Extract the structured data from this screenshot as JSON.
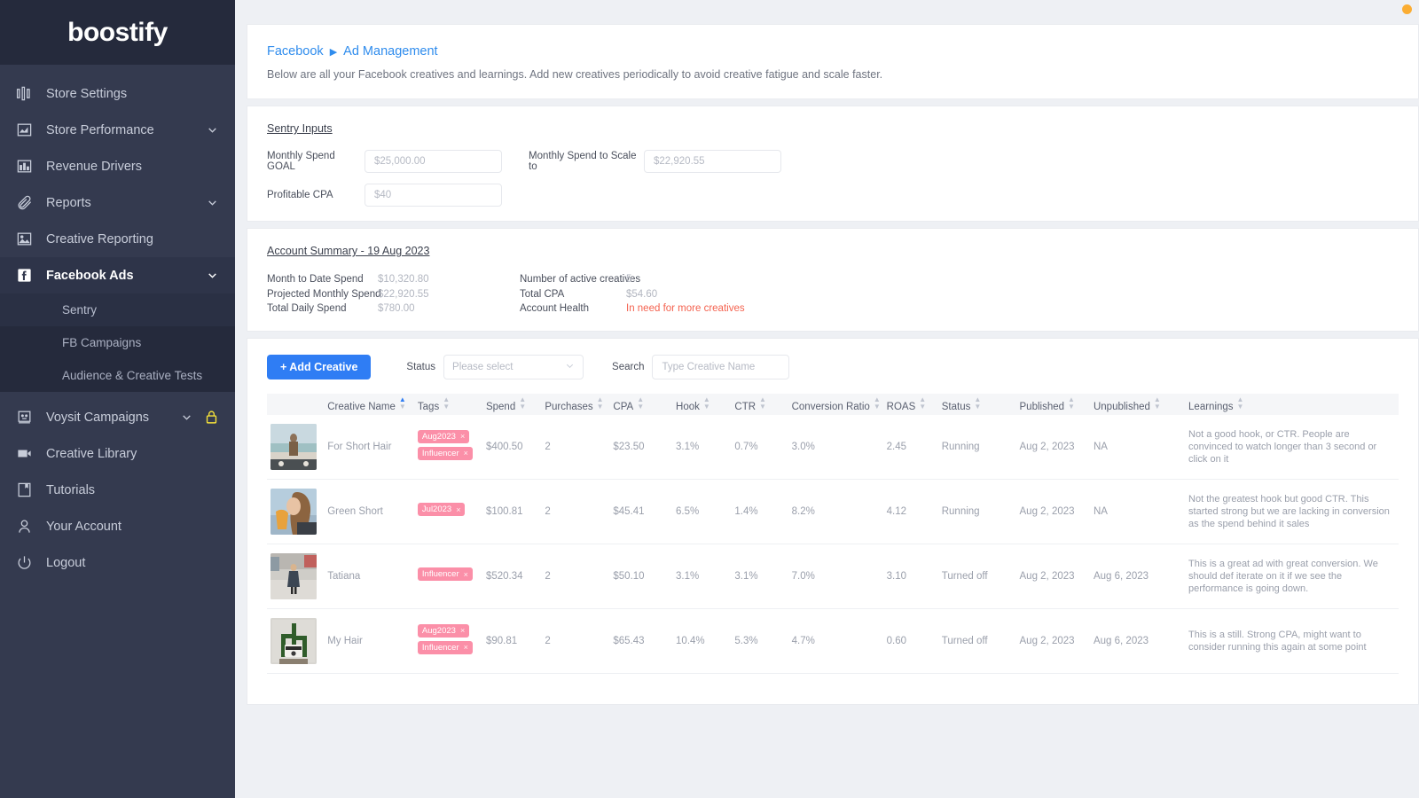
{
  "brand": {
    "logo": "boostify",
    "accent": "#2f7df4",
    "tag_color": "#fb8fa8",
    "alert_color": "#f4624f"
  },
  "sidebar": {
    "items": [
      {
        "label": "Store Settings",
        "icon": "sliders-icon",
        "caret": false
      },
      {
        "label": "Store Performance",
        "icon": "area-chart-icon",
        "caret": true
      },
      {
        "label": "Revenue Drivers",
        "icon": "bar-chart-icon",
        "caret": false
      },
      {
        "label": "Reports",
        "icon": "paperclip-icon",
        "caret": true
      },
      {
        "label": "Creative Reporting",
        "icon": "image-icon",
        "caret": false
      },
      {
        "label": "Facebook Ads",
        "icon": "facebook-icon",
        "caret": true,
        "active": true
      }
    ],
    "sub_items": [
      {
        "label": "Sentry",
        "selected": true
      },
      {
        "label": "FB Campaigns",
        "selected": false
      },
      {
        "label": "Audience & Creative Tests",
        "selected": false
      }
    ],
    "items_lower": [
      {
        "label": "Voysit Campaigns",
        "icon": "robot-icon",
        "caret": true,
        "lock": true
      },
      {
        "label": "Creative Library",
        "icon": "video-icon",
        "caret": false
      },
      {
        "label": "Tutorials",
        "icon": "book-icon",
        "caret": false
      },
      {
        "label": "Your Account",
        "icon": "user-icon",
        "caret": false
      },
      {
        "label": "Logout",
        "icon": "power-icon",
        "caret": false
      }
    ]
  },
  "header": {
    "breadcrumb_root": "Facebook",
    "breadcrumb_current": "Ad Management",
    "subtitle": "Below are all your Facebook creatives and learnings. Add new creatives periodically to avoid creative fatigue and scale faster."
  },
  "sentry_inputs": {
    "title": "Sentry Inputs",
    "fields": [
      {
        "label": "Monthly Spend GOAL",
        "placeholder": "$25,000.00",
        "value": ""
      },
      {
        "label": "Monthly Spend to Scale to",
        "placeholder": "$22,920.55",
        "value": ""
      },
      {
        "label": "Profitable CPA",
        "placeholder": "$40",
        "value": ""
      }
    ]
  },
  "account_summary": {
    "title": "Account Summary - 19 Aug 2023",
    "left": [
      {
        "key": "Month to Date Spend",
        "value": "$10,320.80"
      },
      {
        "key": "Projected Monthly Spend",
        "value": "$22,920.55"
      },
      {
        "key": "Total Daily Spend",
        "value": "$780.00"
      }
    ],
    "right": [
      {
        "key": "Number of active creatives",
        "value": "5"
      },
      {
        "key": "Total  CPA",
        "value": "$54.60"
      },
      {
        "key": "Account Health",
        "value": "In need for more creatives",
        "alert": true
      }
    ]
  },
  "toolbar": {
    "add_creative_label": "+ Add Creative",
    "status_label": "Status",
    "status_placeholder": "Please select",
    "search_label": "Search",
    "search_placeholder": "Type Creative Name"
  },
  "table": {
    "columns": [
      {
        "label": "",
        "key": "thumb"
      },
      {
        "label": "Creative Name",
        "key": "name",
        "sorted": true
      },
      {
        "label": "Tags",
        "key": "tags"
      },
      {
        "label": "Spend",
        "key": "spend"
      },
      {
        "label": "Purchases",
        "key": "purchases"
      },
      {
        "label": "CPA",
        "key": "cpa"
      },
      {
        "label": "Hook",
        "key": "hook"
      },
      {
        "label": "CTR",
        "key": "ctr"
      },
      {
        "label": "Conversion Ratio",
        "key": "cvr"
      },
      {
        "label": "ROAS",
        "key": "roas"
      },
      {
        "label": "Status",
        "key": "status"
      },
      {
        "label": "Published",
        "key": "published"
      },
      {
        "label": "Unpublished",
        "key": "unpublished"
      },
      {
        "label": "Learnings",
        "key": "learnings"
      }
    ],
    "rows": [
      {
        "name": "For Short Hair",
        "tags": [
          "Aug2023",
          "Influencer"
        ],
        "spend": "$400.50",
        "purchases": "2",
        "cpa": "$23.50",
        "hook": "3.1%",
        "ctr": "0.7%",
        "cvr": "3.0%",
        "roas": "2.45",
        "status": "Running",
        "published": "Aug 2, 2023",
        "unpublished": "NA",
        "learnings": "Not a good hook, or CTR. People are convinced to watch longer than 3 second or click on it",
        "thumb": "woman-with-backpack-at-beach"
      },
      {
        "name": "Green Short",
        "tags": [
          "Jul2023"
        ],
        "spend": "$100.81",
        "purchases": "2",
        "cpa": "$45.41",
        "hook": "6.5%",
        "ctr": "1.4%",
        "cvr": "8.2%",
        "roas": "4.12",
        "status": "Running",
        "published": "Aug 2, 2023",
        "unpublished": "NA",
        "learnings": "Not the greatest hook but good CTR. This started strong but we are lacking in conversion as the spend behind it sales",
        "thumb": "woman-drinking-juice"
      },
      {
        "name": "Tatiana",
        "tags": [
          "Influencer"
        ],
        "spend": "$520.34",
        "purchases": "2",
        "cpa": "$50.10",
        "hook": "3.1%",
        "ctr": "3.1%",
        "cvr": "7.0%",
        "roas": "3.10",
        "status": "Turned off",
        "published": "Aug 2, 2023",
        "unpublished": "Aug 6, 2023",
        "learnings": "This is a great ad with great conversion. We should def iterate on it if we see the performance is going down.",
        "thumb": "woman-walking-street"
      },
      {
        "name": "My Hair",
        "tags": [
          "Aug2023",
          "Influencer"
        ],
        "spend": "$90.81",
        "purchases": "2",
        "cpa": "$65.43",
        "hook": "10.4%",
        "ctr": "5.3%",
        "cvr": "4.7%",
        "roas": "0.60",
        "status": "Turned off",
        "published": "Aug 2, 2023",
        "unpublished": "Aug 6, 2023",
        "learnings": "This is a still. Strong CPA, might want to consider running this again at some point",
        "thumb": "cactus-with-camera"
      }
    ]
  }
}
